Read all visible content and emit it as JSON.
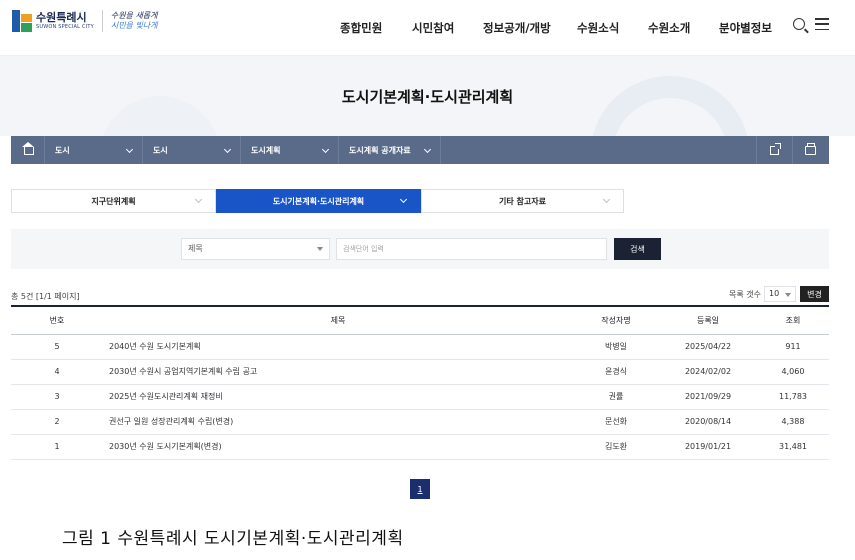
{
  "header": {
    "logo": {
      "name": "수원특례시",
      "sub": "SUWON SPECIAL CITY"
    },
    "slogan": {
      "line1": "수원을 새롭게",
      "line2": "시민을 빛나게"
    },
    "nav": [
      "종합민원",
      "시민참여",
      "정보공개/개방",
      "수원소식",
      "수원소개",
      "분야별정보"
    ]
  },
  "page": {
    "title": "도시기본계획·도시관리계획"
  },
  "breadcrumb": {
    "items": [
      "도시",
      "도시",
      "도시계획",
      "도시계획 공개자료"
    ]
  },
  "tabs": [
    {
      "label": "지구단위계획",
      "active": false
    },
    {
      "label": "도시기본계획·도시관리계획",
      "active": true
    },
    {
      "label": "기타 참고자료",
      "active": false
    }
  ],
  "search": {
    "select_value": "제목",
    "keyword_placeholder": "검색단어 입력",
    "button_label": "검색"
  },
  "board": {
    "total_text": "총 5건 [1/1 페이지]",
    "per_page_label": "목록 갯수",
    "per_page_value": "10",
    "change_button": "변경",
    "columns": [
      "번호",
      "제목",
      "작성자명",
      "등록일",
      "조회"
    ],
    "rows": [
      {
        "no": "5",
        "title": "2040년 수원 도시기본계획",
        "writer": "박병일",
        "date": "2025/04/22",
        "views": "911"
      },
      {
        "no": "4",
        "title": "2030년 수원시 공업지역기본계획 수립 공고",
        "writer": "윤경식",
        "date": "2024/02/02",
        "views": "4,060"
      },
      {
        "no": "3",
        "title": "2025년 수원도시관리계획 재정비",
        "writer": "권률",
        "date": "2021/09/29",
        "views": "11,783"
      },
      {
        "no": "2",
        "title": "권선구 일원 성장관리계획 수립(변경)",
        "writer": "문선화",
        "date": "2020/08/14",
        "views": "4,388"
      },
      {
        "no": "1",
        "title": "2030년 수원 도시기본계획(변경)",
        "writer": "김도환",
        "date": "2019/01/21",
        "views": "31,481"
      }
    ]
  },
  "pagination": {
    "current": "1"
  },
  "caption": "그림 1 수원특례시 도시기본계획·도시관리계획"
}
